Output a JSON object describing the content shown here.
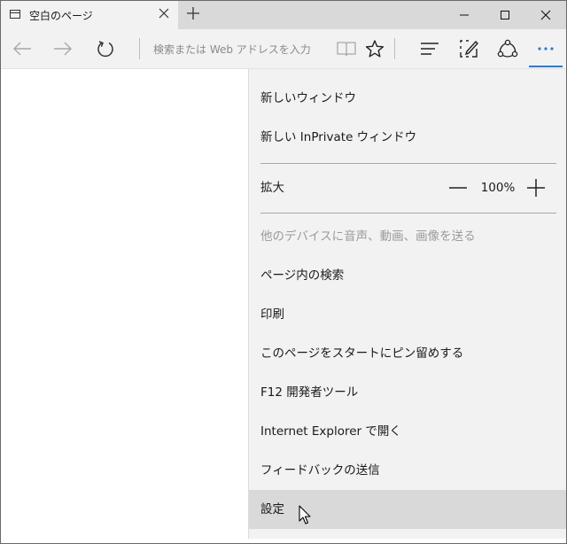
{
  "tab": {
    "title": "空白のページ",
    "close_icon": "close-icon",
    "new_tab_label": "+"
  },
  "window_controls": [
    "minimize-icon",
    "maximize-icon",
    "close-icon"
  ],
  "toolbar": {
    "icons": [
      "back-arrow-icon",
      "forward-arrow-icon",
      "refresh-icon",
      "reading-view-icon",
      "favorite-star-icon",
      "hub-icon",
      "web-note-icon",
      "share-icon",
      "more-icon"
    ],
    "address_placeholder": "検索または Web アドレスを入力"
  },
  "menu": {
    "new_window": "新しいウィンドウ",
    "new_inprivate": "新しい InPrivate ウィンドウ",
    "zoom": {
      "label": "拡大",
      "value": "100%"
    },
    "cast": "他のデバイスに音声、動画、画像を送る",
    "find": "ページ内の検索",
    "print": "印刷",
    "pin_start": "このページをスタートにピン留めする",
    "dev_tools": "F12 開発者ツール",
    "open_ie": "Internet Explorer で開く",
    "feedback": "フィードバックの送信",
    "settings": "設定"
  },
  "colors": {
    "accent": "#2b7bd6",
    "menu_background": "#f2f2f2",
    "hover_background": "#d9d9d9",
    "disabled_text": "#9a9a9a"
  }
}
